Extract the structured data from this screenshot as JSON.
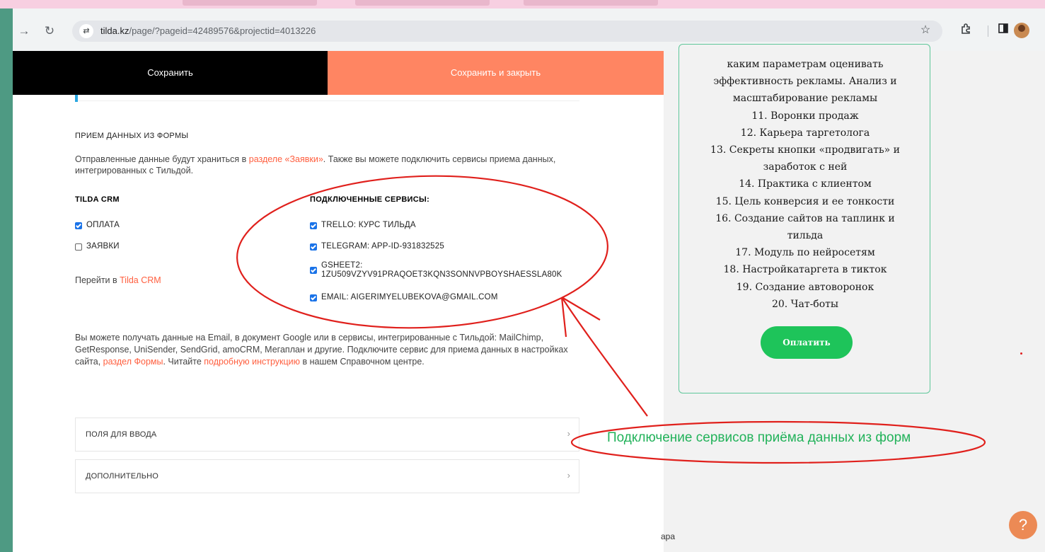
{
  "browser": {
    "url_domain": "tilda.kz",
    "url_path": "/page/?pageid=42489576&projectid=4013226",
    "icons": [
      "back-icon",
      "reload-icon",
      "site-settings-icon",
      "star-icon",
      "extensions-icon",
      "sidepanel-icon",
      "profile-icon"
    ]
  },
  "editor": {
    "save_label": "Сохранить",
    "save_close_label": "Сохранить и закрыть",
    "section_title": "ПРИЕМ ДАННЫХ ИЗ ФОРМЫ",
    "desc_1": "Отправленные данные будут храниться в ",
    "desc_link": "разделе «Заявки»",
    "desc_2": ". Также вы можете подключить сервисы приема данных, интегрированных с Тильдой.",
    "crm_head": "TILDA CRM",
    "crm_items": [
      {
        "label": "ОПЛАТА",
        "checked": true
      },
      {
        "label": "ЗАЯВКИ",
        "checked": false
      }
    ],
    "crm_link_prefix": "Перейти в ",
    "crm_link": "Tilda CRM",
    "services_head": "ПОДКЛЮЧЕННЫЕ СЕРВИСЫ:",
    "services": [
      {
        "label": "TRELLO: КУРС ТИЛЬДА",
        "checked": true
      },
      {
        "label": "TELEGRAM: APP-ID-931832525",
        "checked": true
      },
      {
        "label_1": "GSHEET2:",
        "label_2": "1ZU509VZYV91PRAQOET3KQN3SONNVPBOYSHAESSLA80K",
        "checked": true
      },
      {
        "label": "EMAIL: AIGERIMYELUBEKOVA@GMAIL.COM",
        "checked": true
      }
    ],
    "para2_1": "Вы можете получать данные на Email, в документ Google или в сервисы, интегрированные с Тильдой: MailChimp, GetResponse, UniSender, SendGrid, amoCRM, Мегаплан и другие. Подключите сервис для приема данных в настройках сайта, ",
    "para2_link1": "раздел Формы",
    "para2_2": ". Читайте ",
    "para2_link2": "подробную инструкцию",
    "para2_3": " в нашем Справочном центре.",
    "accordion": [
      {
        "label": "ПОЛЯ ДЛЯ ВВОДА"
      },
      {
        "label": "ДОПОЛНИТЕЛЬНО"
      }
    ]
  },
  "course": {
    "lines": [
      "каким параметрам оценивать",
      "эффективность рекламы. Анализ и",
      "масштабирование рекламы",
      "11. Воронки продаж",
      "12. Карьера таргетолога",
      "13. Секреты кнопки «продвигать» и",
      "заработок с ней",
      "14. Практика с клиентом",
      "15. Цель конверсия и ее тонкости",
      "16. Создание сайтов на таплинк и",
      "тильда",
      "17. Модуль по нейросетям",
      "18. Настройкатаргета в тикток",
      "19. Создание автоворонок",
      "20. Чат-боты"
    ],
    "pay_label": "Оплатить",
    "partial_word": "ара",
    "help_label": "?"
  },
  "annotation": {
    "caption": "Подключение сервисов приёма данных из форм",
    "color": "#e0201c"
  },
  "colors": {
    "accent_orange": "#ff8562",
    "link_red": "#ff5f3f",
    "checkbox_blue": "#1a73e8",
    "pay_green": "#1ec45a",
    "caption_green": "#22b25a",
    "frame_teal": "#4e9a83"
  }
}
